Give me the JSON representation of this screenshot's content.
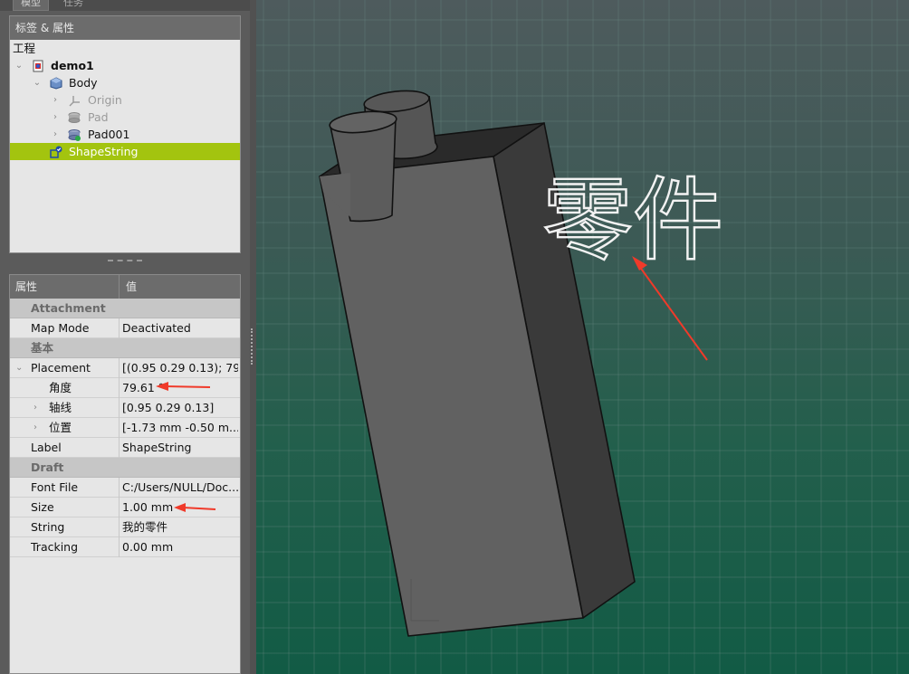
{
  "tabs": [
    {
      "label": "模型"
    },
    {
      "label": "任务"
    }
  ],
  "tree": {
    "header": "标签 & 属性",
    "root_label": "工程",
    "items": [
      {
        "label": "demo1"
      },
      {
        "label": "Body"
      },
      {
        "label": "Origin"
      },
      {
        "label": "Pad"
      },
      {
        "label": "Pad001"
      },
      {
        "label": "ShapeString"
      }
    ]
  },
  "properties": {
    "header_name": "属性",
    "header_value": "值",
    "rows": [
      {
        "name": "Attachment",
        "value": ""
      },
      {
        "name": "Map Mode",
        "value": "Deactivated"
      },
      {
        "name": "基本",
        "value": ""
      },
      {
        "name": "Placement",
        "value": "[(0.95 0.29 0.13); 79...."
      },
      {
        "name": "角度",
        "value": "79.61 °"
      },
      {
        "name": "轴线",
        "value": "[0.95 0.29 0.13]"
      },
      {
        "name": "位置",
        "value": "[-1.73 mm  -0.50 m..."
      },
      {
        "name": "Label",
        "value": "ShapeString"
      },
      {
        "name": "Draft",
        "value": ""
      },
      {
        "name": "Font File",
        "value": "C:/Users/NULL/Doc..."
      },
      {
        "name": "Size",
        "value": "1.00 mm"
      },
      {
        "name": "String",
        "value": "我的零件"
      },
      {
        "name": "Tracking",
        "value": "0.00 mm"
      }
    ]
  },
  "viewport": {
    "shape_text": "零件"
  },
  "colors": {
    "selection": "#a3c40f",
    "annotation_arrow": "#f03a2a",
    "model_face": "#616161",
    "model_side": "#3a3a3a"
  }
}
